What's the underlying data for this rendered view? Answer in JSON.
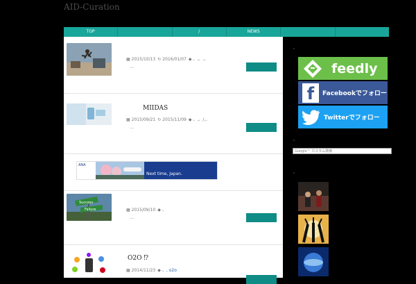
{
  "site": {
    "title": "AID-Curation"
  },
  "nav": {
    "items": [
      "TOP",
      "",
      "/",
      "NEWS",
      "",
      ""
    ]
  },
  "posts": [
    {
      "title": "",
      "date": "2015/10/13",
      "updated": "2016/01/07",
      "tags": "、,、,、",
      "excerpt": "…"
    },
    {
      "title": "MIIDAS",
      "date": "2015/09/21",
      "updated": "2015/11/09",
      "tags": "、,、/,、",
      "excerpt": "…"
    },
    {
      "title": "",
      "date": "2015/09/10",
      "updated": "",
      "tags": "、",
      "excerpt": "…"
    },
    {
      "title": "O2O        ⁉",
      "date": "2014/11/23",
      "updated": "",
      "tags": "、, o2o",
      "excerpt": ""
    }
  ],
  "ad": {
    "brand": "ANA",
    "caption": "Next time, Japan."
  },
  "sidebar": {
    "feedly_label": "feedly",
    "facebook_label": "Facebookでフォロー",
    "twitter_label": "Twitterでフォロー",
    "search_placeholder": "Google™ カスタム検索"
  },
  "icons": {
    "calendar": "calendar-icon",
    "refresh": "refresh-icon",
    "tag": "tag-icon"
  },
  "colors": {
    "accent": "#19a69a",
    "button": "#0f8c86",
    "feedly": "#6cc04a",
    "facebook": "#3b5998",
    "twitter": "#1da1f2"
  }
}
